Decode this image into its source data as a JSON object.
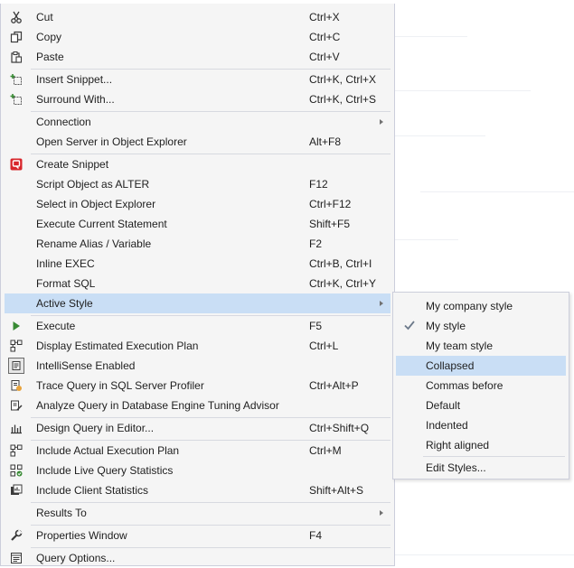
{
  "menu": {
    "items": [
      {
        "label": "Cut",
        "shortcut": "Ctrl+X",
        "icon": "scissors-icon"
      },
      {
        "label": "Copy",
        "shortcut": "Ctrl+C",
        "icon": "copy-icon"
      },
      {
        "label": "Paste",
        "shortcut": "Ctrl+V",
        "icon": "paste-icon"
      },
      {
        "label": "Insert Snippet...",
        "shortcut": "Ctrl+K, Ctrl+X",
        "icon": "insert-snippet-icon"
      },
      {
        "label": "Surround With...",
        "shortcut": "Ctrl+K, Ctrl+S",
        "icon": "surround-with-icon"
      },
      {
        "label": "Connection",
        "shortcut": "",
        "icon": ""
      },
      {
        "label": "Open Server in Object Explorer",
        "shortcut": "Alt+F8",
        "icon": ""
      },
      {
        "label": "Create Snippet",
        "shortcut": "",
        "icon": "create-snippet-icon"
      },
      {
        "label": "Script Object as ALTER",
        "shortcut": "F12",
        "icon": ""
      },
      {
        "label": "Select in Object Explorer",
        "shortcut": "Ctrl+F12",
        "icon": ""
      },
      {
        "label": "Execute Current Statement",
        "shortcut": "Shift+F5",
        "icon": ""
      },
      {
        "label": "Rename Alias / Variable",
        "shortcut": "F2",
        "icon": ""
      },
      {
        "label": "Inline EXEC",
        "shortcut": "Ctrl+B, Ctrl+I",
        "icon": ""
      },
      {
        "label": "Format SQL",
        "shortcut": "Ctrl+K, Ctrl+Y",
        "icon": ""
      },
      {
        "label": "Active Style",
        "shortcut": "",
        "icon": ""
      },
      {
        "label": "Execute",
        "shortcut": "F5",
        "icon": "execute-play-icon"
      },
      {
        "label": "Display Estimated Execution Plan",
        "shortcut": "Ctrl+L",
        "icon": "estimated-plan-icon"
      },
      {
        "label": "IntelliSense Enabled",
        "shortcut": "",
        "icon": "intellisense-icon"
      },
      {
        "label": "Trace Query in SQL Server Profiler",
        "shortcut": "Ctrl+Alt+P",
        "icon": "profiler-icon"
      },
      {
        "label": "Analyze Query in Database Engine Tuning Advisor",
        "shortcut": "",
        "icon": "tuning-advisor-icon"
      },
      {
        "label": "Design Query in Editor...",
        "shortcut": "Ctrl+Shift+Q",
        "icon": "design-query-icon"
      },
      {
        "label": "Include Actual Execution Plan",
        "shortcut": "Ctrl+M",
        "icon": "actual-plan-icon"
      },
      {
        "label": "Include Live Query Statistics",
        "shortcut": "",
        "icon": "live-stats-icon"
      },
      {
        "label": "Include Client Statistics",
        "shortcut": "Shift+Alt+S",
        "icon": "client-stats-icon"
      },
      {
        "label": "Results To",
        "shortcut": "",
        "icon": ""
      },
      {
        "label": "Properties Window",
        "shortcut": "F4",
        "icon": "wrench-icon"
      },
      {
        "label": "Query Options...",
        "shortcut": "",
        "icon": "query-options-icon"
      }
    ]
  },
  "submenu": {
    "items": [
      {
        "label": "My company style"
      },
      {
        "label": "My style",
        "checked": true
      },
      {
        "label": "My team style"
      },
      {
        "label": "Collapsed"
      },
      {
        "label": "Commas before"
      },
      {
        "label": "Default"
      },
      {
        "label": "Indented"
      },
      {
        "label": "Right aligned"
      },
      {
        "label": "Edit Styles..."
      }
    ]
  },
  "colors": {
    "highlight": "#c9def5",
    "menu_bg": "#f5f5f5",
    "border": "#cccedb"
  }
}
